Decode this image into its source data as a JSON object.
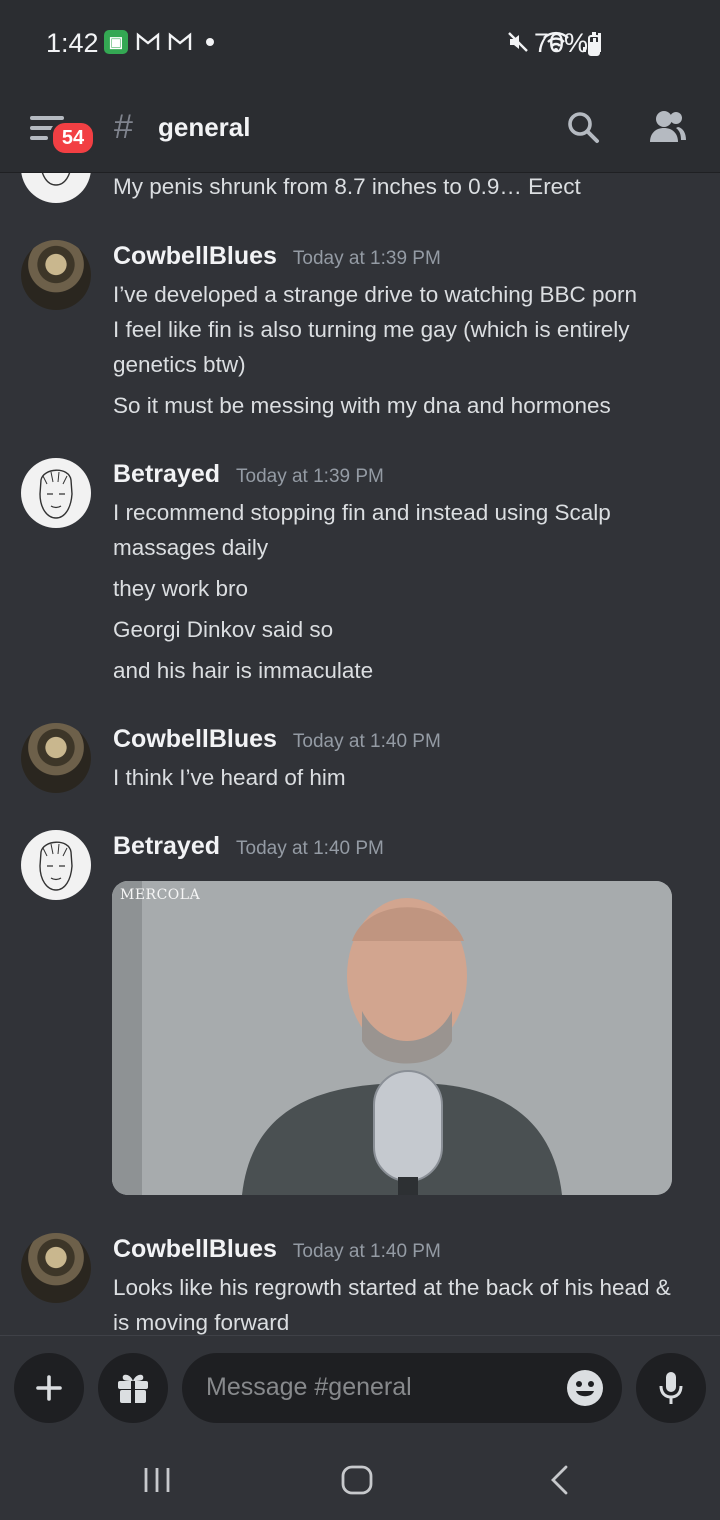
{
  "status_bar": {
    "time": "1:42",
    "battery": "70%",
    "battery_level": 0.7
  },
  "header": {
    "notification_count": "54",
    "channel_name": "general"
  },
  "messages": [
    {
      "type": "continuation",
      "lines": [
        "My penis shrunk from 8.7 inches to 0.9… Erect"
      ]
    },
    {
      "author": "CowbellBlues",
      "timestamp": "Today at 1:39 PM",
      "lines": [
        "I’ve developed a strange drive to watching BBC porn",
        "I feel like fin is also turning me gay (which is entirely",
        "genetics btw)",
        "So it must be messing with my dna and hormones"
      ]
    },
    {
      "author": "Betrayed",
      "timestamp": "Today at 1:39 PM",
      "lines": [
        "I recommend stopping fin and instead using Scalp",
        "massages daily",
        "they work bro",
        "Georgi Dinkov said so",
        "and his hair is immaculate"
      ]
    },
    {
      "author": "CowbellBlues",
      "timestamp": "Today at 1:40 PM",
      "lines": [
        "I think I’ve heard of him"
      ]
    },
    {
      "author": "Betrayed",
      "timestamp": "Today at 1:40 PM",
      "image_watermark": "MERCOLA"
    },
    {
      "author": "CowbellBlues",
      "timestamp": "Today at 1:40 PM",
      "lines": [
        "Looks like his regrowth started at the back of his head &",
        "is moving forward"
      ]
    }
  ],
  "composer": {
    "placeholder": "Message #general"
  },
  "icons": {
    "status": [
      "app-icon",
      "gmail-icon",
      "gmail-icon",
      "mute-icon",
      "wifi-icon",
      "signal-icon",
      "battery-icon"
    ],
    "header": [
      "menu-icon",
      "hash-icon",
      "search-icon",
      "members-icon"
    ],
    "composer": [
      "plus-icon",
      "gift-icon",
      "emoji-icon",
      "microphone-icon"
    ],
    "nav": [
      "recent-apps-icon",
      "home-icon",
      "back-icon"
    ]
  },
  "colors": {
    "background": "#313338",
    "header": "#2b2d31",
    "badge": "#f23f43",
    "input": "#1e1f22",
    "text": "#dbdee1",
    "muted": "#949ba4"
  }
}
